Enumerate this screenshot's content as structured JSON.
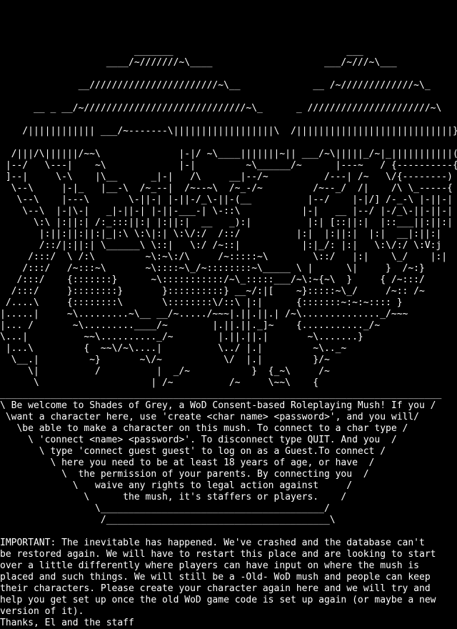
{
  "terminal": {
    "colors": {
      "background": "#000000",
      "foreground": "#ffffff"
    },
    "art_lines": [
      "",
      "",
      "",
      "",
      "                        _______                               ___",
      "                   ____/~///////~\\____                    ___/~///~\\___",
      "",
      "              __///////////////////////~\\__             __ /~/////////////~\\_",
      "",
      "      __ _ __/~/////////////////////////////~\\_      _ //////////////////////~\\",
      "",
      "    /|||||||||||| ___/~-------\\||||||||||||||||||\\  /||||||||||||||||||||||||||||}",
      "",
      "  /|||/\\||||||/~~\\              |-|/ ~\\____|||||||~|| ___/~\\|||||_/~|_|||||||||||(",
      " |--/   \\---|    ~\\             |-|         ~\\______/~      |---~   / {----------{",
      " ]--|     \\-\\    |\\__      _|-|   /\\     __|--/~          /---| /~   \\/{--------)",
      "  \\--\\     |-|_   |__-\\  /~_--|  /~--~\\  /~_-/~         /~--_/  /|    /\\ \\_-----{",
      "   \\--\\    |---\\       \\-||-| |-||-/_\\-||-(__          |--/    |-|/] /-_-\\ |-||-|",
      "    \\--\\  |-|\\-|   _|-||-| |-||-___-| \\-::\\           |-|   __ |--/ |-/_\\-||-||-|",
      "      \\:\\ |:||:| /:_:::||:| |:||:|  __   _):|          |:| [::||:|  |::___||:||:|",
      "       |:||:||:||:|_|:\\ \\:\\|:| \\:\\/:/  /::/          |:|  |:||:|  |:|  __|:||:|",
      "       /::/|:||:| \\______\\ \\::|   \\:/ /~::|           |:|_/: |:|   \\:\\/:/ \\:V:j",
      "     /:::/  \\ /:\\         ~\\:~\\:/\\     /~:::::~\\        \\::/   |:|    \\_/    |:|",
      "    /:::/   /~:::~\\       ~\\::::~\\_/~::::::::~\\_____ \\ |      \\|     }  /~:}",
      "   /:::/    {:::::::}      ~\\:::::::::::/~\\_:::::___/~\\:~{~\\  }     { /~:::/",
      "  /:::/     }::::::::}       }::::::::::} __~/:|[    ~}:::::~\\_/     /~:: /~",
      " /....\\     {::::::::\\       \\::::::::\\/::\\ |:|      {:::::::~:~:~:::: }",
      "|.....|     ~\\.........~\\__ __/~...../~~~|.||.||.| /~\\.............._/~~~",
      "|... /       ~\\.........____/~        |.||.||._]~    {..........._/~",
      "\\...|          ~~\\.........._/~        |.||.||.|       ~\\.......}",
      " |...\\         {  ~~\\/~\\....|          \\../ |.|         ~\\.._~",
      "  \\__.|         ~}       ~\\/~           \\/  |.|         }/~",
      "     \\|          /          |  _/~           }  {_~\\     /~",
      "      \\                    | /~          /~     \\~~\\    {"
    ],
    "banner_lines": [
      "_______________________________________________________________________________",
      "\\ Be welcome to Shades of Grey, a WoD Consent-based Roleplaying Mush! If you /",
      " \\want a character here, use 'create <char name> <password>', and you will/",
      "   \\be able to make a character on this mush. To connect to a char type /",
      "     \\ 'connect <name> <password>'. To disconnect type QUIT. And you  /",
      "       \\ type 'connect guest guest' to log on as a Guest.To connect /",
      "         \\ here you need to be at least 18 years of age, or have  /",
      "           \\  the permission of your parents. By connecting you  /",
      "             \\   waive any rights to legal action against     /",
      "               \\      the mush, it's staffers or players.    /",
      "                 \\________________________________________/",
      "                  /________________________________________\\"
    ],
    "notice_lines": [
      "",
      "IMPORTANT: The inevitable has happened. We've crashed and the database can't",
      "be restored again. We will have to restart this place and are looking to start",
      "over a little differently where players can have input on where the mush is",
      "placed and such things. We will still be a -Old- WoD mush and people can keep",
      "their characters. Please create your character again here and we will try and",
      "help you get set up once the old WoD game code is set up again (or maybe a new",
      "version of it).",
      "Thanks, El and the staff"
    ]
  }
}
